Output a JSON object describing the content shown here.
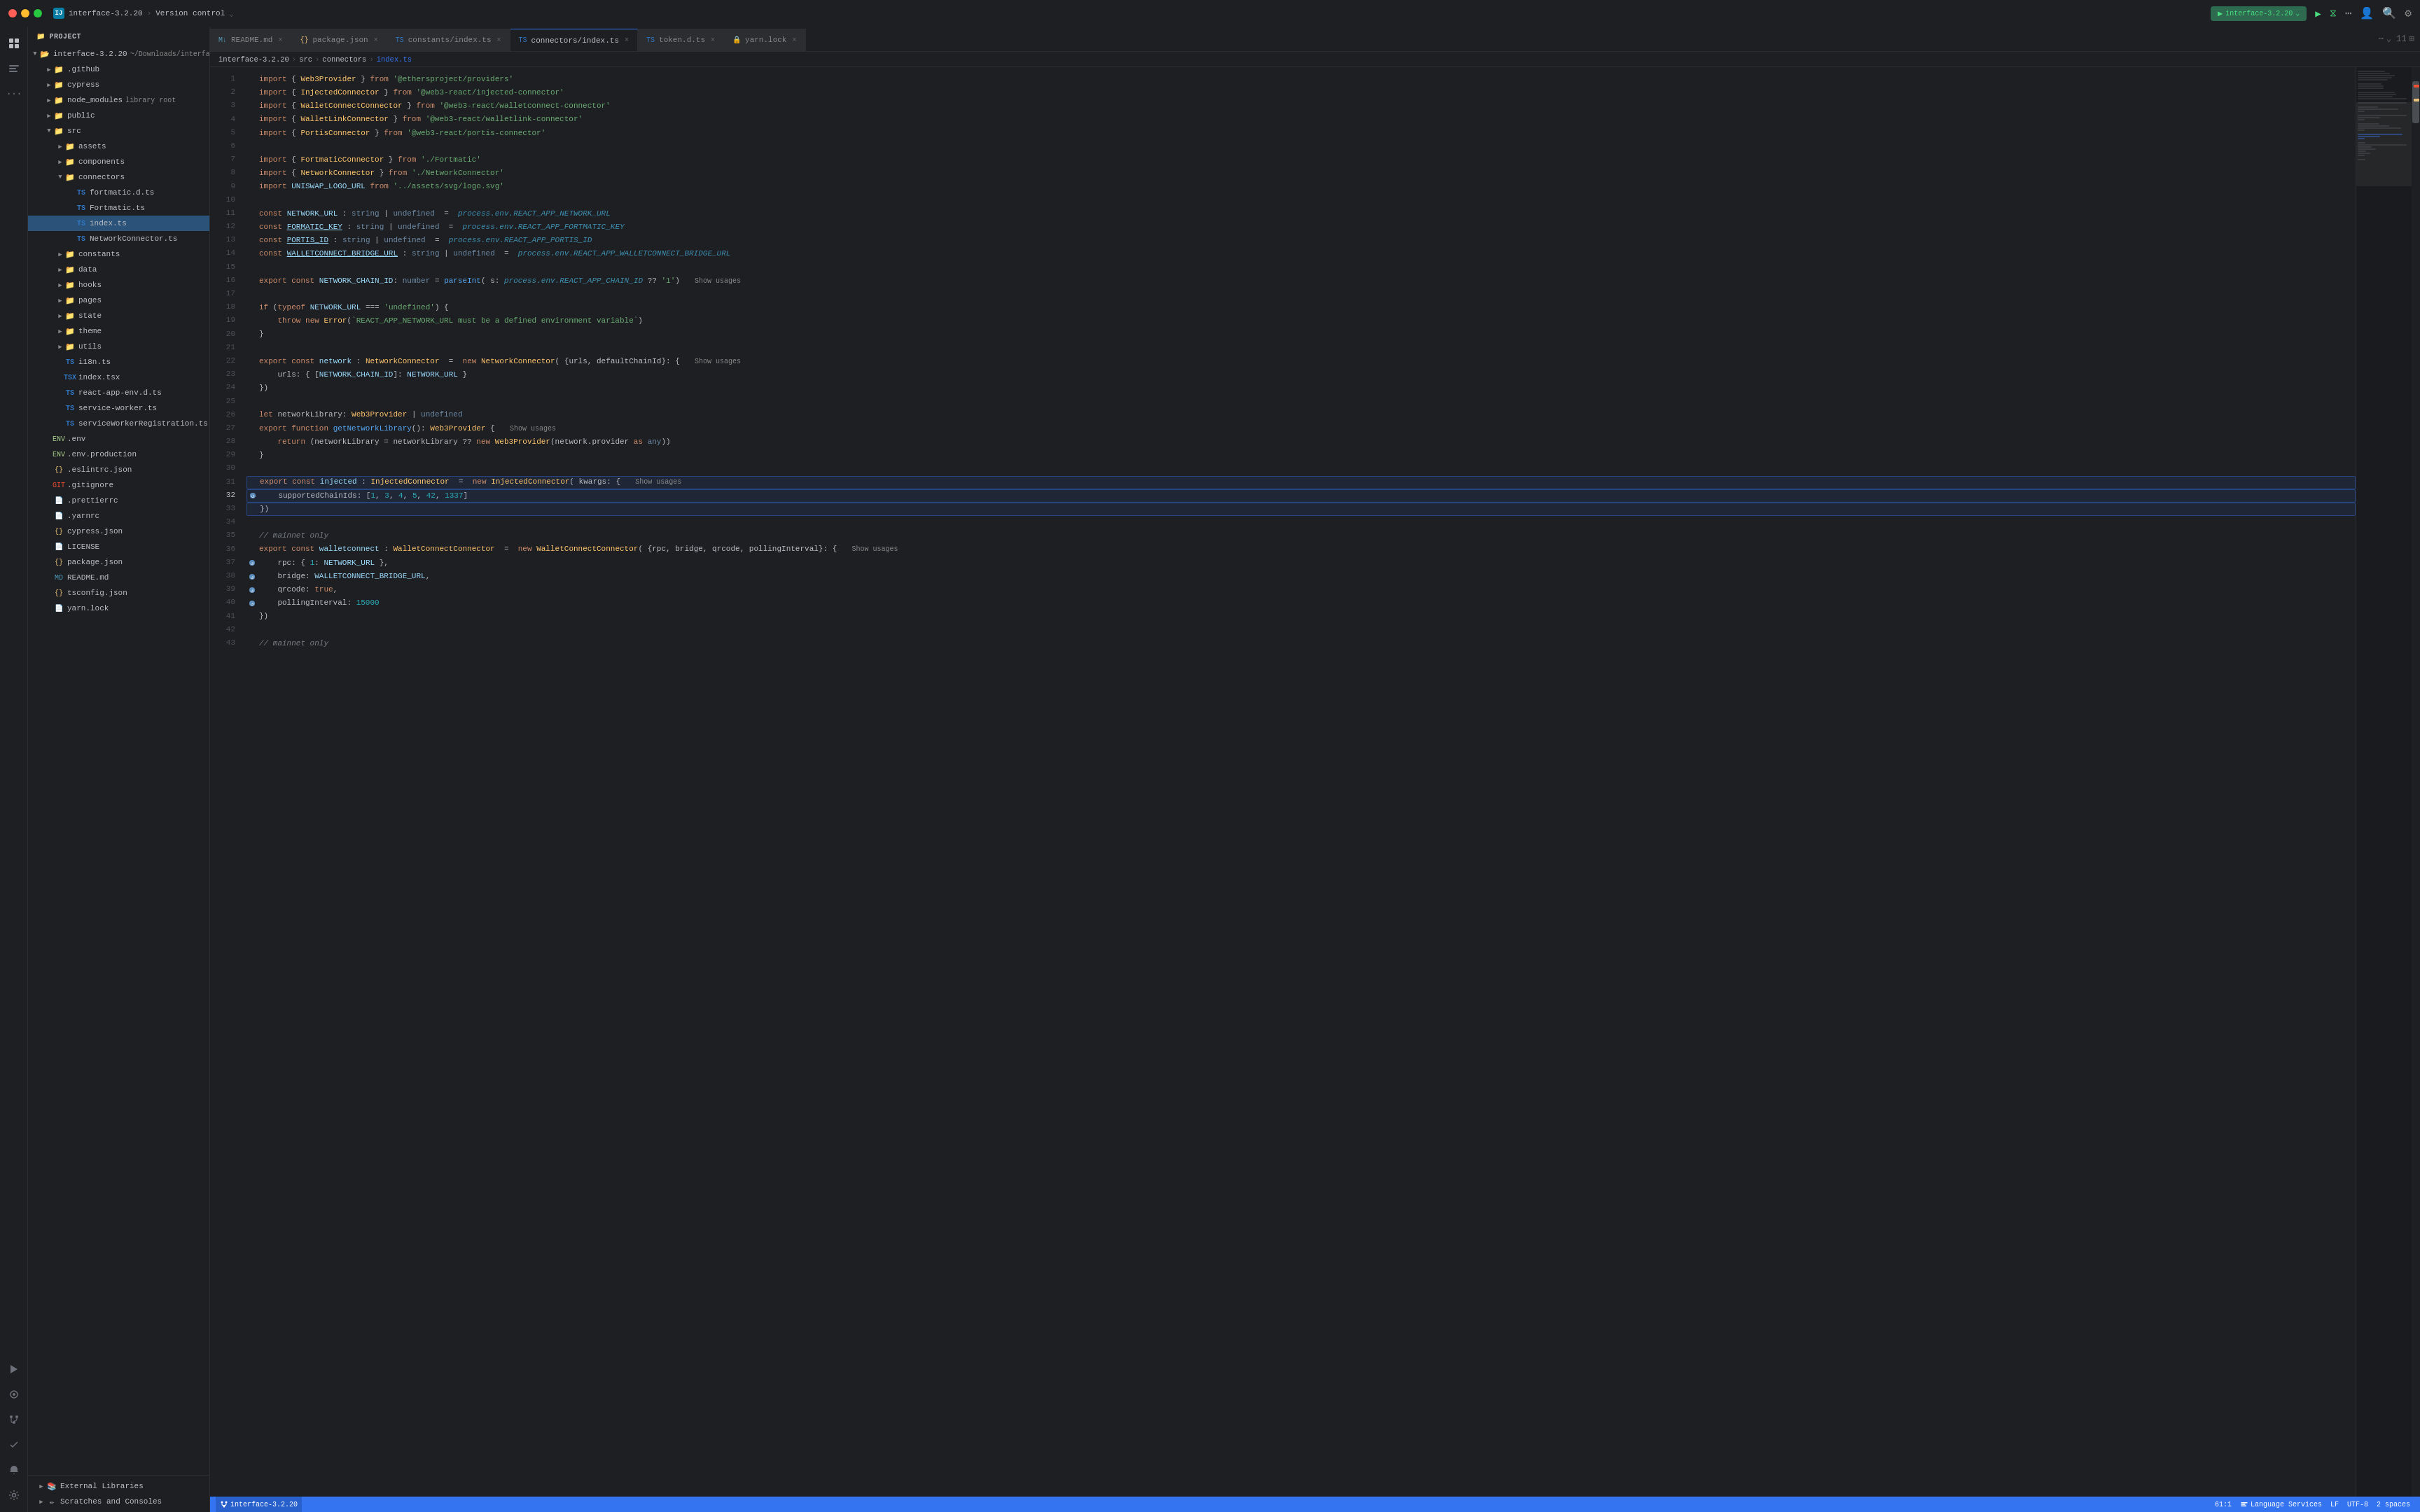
{
  "titleBar": {
    "trafficLights": [
      "close",
      "minimize",
      "maximize"
    ],
    "appName": "interface-3.2.20",
    "appVersion": "interface-3.2.20",
    "versionControl": "Version control",
    "runConfig": "start",
    "appIconLabel": "IJ"
  },
  "activityBar": {
    "icons": [
      {
        "name": "project-icon",
        "symbol": "📁"
      },
      {
        "name": "structure-icon",
        "symbol": "⊞"
      },
      {
        "name": "more-icon",
        "symbol": "···"
      },
      {
        "name": "run-icon",
        "symbol": "▶"
      },
      {
        "name": "debug-icon",
        "symbol": "🐛"
      },
      {
        "name": "git-icon",
        "symbol": "⎇"
      },
      {
        "name": "todo-icon",
        "symbol": "✓"
      },
      {
        "name": "notifications-icon",
        "symbol": "🔔"
      },
      {
        "name": "settings-icon",
        "symbol": "⚙"
      }
    ]
  },
  "sidebar": {
    "header": "Project",
    "tree": [
      {
        "id": "root",
        "label": "interface-3.2.20",
        "suffix": "~/Downloads/interface-3.2.20",
        "type": "folder-open",
        "depth": 0,
        "expanded": true
      },
      {
        "id": "github",
        "label": ".github",
        "type": "folder",
        "depth": 1,
        "expanded": false
      },
      {
        "id": "cypress",
        "label": "cypress",
        "type": "folder",
        "depth": 1,
        "expanded": false
      },
      {
        "id": "node_modules",
        "label": "node_modules",
        "suffix": "library root",
        "type": "folder",
        "depth": 1,
        "expanded": false
      },
      {
        "id": "public",
        "label": "public",
        "type": "folder",
        "depth": 1,
        "expanded": false
      },
      {
        "id": "src",
        "label": "src",
        "type": "folder",
        "depth": 1,
        "expanded": true
      },
      {
        "id": "assets",
        "label": "assets",
        "type": "folder",
        "depth": 2,
        "expanded": false
      },
      {
        "id": "components",
        "label": "components",
        "type": "folder",
        "depth": 2,
        "expanded": false
      },
      {
        "id": "connectors",
        "label": "connectors",
        "type": "folder",
        "depth": 2,
        "expanded": true
      },
      {
        "id": "fortmatic.d.ts",
        "label": "fortmatic.d.ts",
        "type": "ts",
        "depth": 3
      },
      {
        "id": "Fortmatic.ts",
        "label": "Fortmatic.ts",
        "type": "ts",
        "depth": 3
      },
      {
        "id": "index.ts",
        "label": "index.ts",
        "type": "ts",
        "depth": 3,
        "selected": true
      },
      {
        "id": "NetworkConnector.ts",
        "label": "NetworkConnector.ts",
        "type": "ts",
        "depth": 3
      },
      {
        "id": "constants",
        "label": "constants",
        "type": "folder",
        "depth": 2,
        "expanded": false
      },
      {
        "id": "data",
        "label": "data",
        "type": "folder",
        "depth": 2,
        "expanded": false
      },
      {
        "id": "hooks",
        "label": "hooks",
        "type": "folder",
        "depth": 2,
        "expanded": false
      },
      {
        "id": "pages",
        "label": "pages",
        "type": "folder",
        "depth": 2,
        "expanded": false
      },
      {
        "id": "state",
        "label": "state",
        "type": "folder",
        "depth": 2,
        "expanded": false
      },
      {
        "id": "theme",
        "label": "theme",
        "type": "folder",
        "depth": 2,
        "expanded": false
      },
      {
        "id": "utils",
        "label": "utils",
        "type": "folder",
        "depth": 2,
        "expanded": false
      },
      {
        "id": "i18n.ts",
        "label": "i18n.ts",
        "type": "ts",
        "depth": 2
      },
      {
        "id": "index.tsx",
        "label": "index.tsx",
        "type": "tsx",
        "depth": 2
      },
      {
        "id": "react-app-env.d.ts",
        "label": "react-app-env.d.ts",
        "type": "ts",
        "depth": 2
      },
      {
        "id": "service-worker.ts",
        "label": "service-worker.ts",
        "type": "ts",
        "depth": 2
      },
      {
        "id": "serviceWorkerRegistration.ts",
        "label": "serviceWorkerRegistration.ts",
        "type": "ts",
        "depth": 2
      },
      {
        "id": ".env",
        "label": ".env",
        "type": "env",
        "depth": 1
      },
      {
        "id": ".env.production",
        "label": ".env.production",
        "type": "env",
        "depth": 1
      },
      {
        "id": ".eslintrc.json",
        "label": ".eslintrc.json",
        "type": "json",
        "depth": 1
      },
      {
        "id": ".gitignore",
        "label": ".gitignore",
        "type": "git",
        "depth": 1
      },
      {
        "id": ".prettierrc",
        "label": ".prettierrc",
        "type": "file",
        "depth": 1
      },
      {
        "id": ".yarnrc",
        "label": ".yarnrc",
        "type": "file",
        "depth": 1
      },
      {
        "id": "cypress.json",
        "label": "cypress.json",
        "type": "json",
        "depth": 1
      },
      {
        "id": "LICENSE",
        "label": "LICENSE",
        "type": "file",
        "depth": 1
      },
      {
        "id": "package.json",
        "label": "package.json",
        "type": "json",
        "depth": 1
      },
      {
        "id": "README.md",
        "label": "README.md",
        "type": "md",
        "depth": 1
      },
      {
        "id": "tsconfig.json",
        "label": "tsconfig.json",
        "type": "json",
        "depth": 1
      },
      {
        "id": "yarn.lock",
        "label": "yarn.lock",
        "type": "file",
        "depth": 1
      }
    ],
    "bottomItems": [
      {
        "id": "external-libs",
        "label": "External Libraries",
        "type": "folder"
      },
      {
        "id": "scratches",
        "label": "Scratches and Consoles",
        "type": "folder"
      }
    ]
  },
  "tabs": [
    {
      "id": "readme",
      "label": "README.md",
      "type": "md",
      "active": false,
      "modified": false
    },
    {
      "id": "package",
      "label": "package.json",
      "type": "json",
      "active": false,
      "modified": false
    },
    {
      "id": "constants",
      "label": "constants/index.ts",
      "type": "ts",
      "active": false,
      "modified": false
    },
    {
      "id": "connectors",
      "label": "connectors/index.ts",
      "type": "ts",
      "active": true,
      "modified": false
    },
    {
      "id": "token",
      "label": "token.d.ts",
      "type": "ts",
      "active": false,
      "modified": false
    },
    {
      "id": "yarn",
      "label": "yarn.lock",
      "type": "lock",
      "active": false,
      "modified": false
    }
  ],
  "breadcrumb": {
    "items": [
      "interface-3.2.20",
      "src",
      "connectors",
      "index.ts"
    ]
  },
  "editor": {
    "filename": "index.ts",
    "lines": [
      {
        "num": 1,
        "content": "import { Web3Provider } from '@ethersproject/providers'"
      },
      {
        "num": 2,
        "content": "import { InjectedConnector } from '@web3-react/injected-connector'"
      },
      {
        "num": 3,
        "content": "import { WalletConnectConnector } from '@web3-react/walletconnect-connector'"
      },
      {
        "num": 4,
        "content": "import { WalletLinkConnector } from '@web3-react/walletlink-connector'"
      },
      {
        "num": 5,
        "content": "import { PortisConnector } from '@web3-react/portis-connector'"
      },
      {
        "num": 6,
        "content": ""
      },
      {
        "num": 7,
        "content": "import { FortmaticConnector } from './Fortmatic'"
      },
      {
        "num": 8,
        "content": "import { NetworkConnector } from './NetworkConnector'"
      },
      {
        "num": 9,
        "content": "import UNISWAP_LOGO_URL from '../assets/svg/logo.svg'"
      },
      {
        "num": 10,
        "content": ""
      },
      {
        "num": 11,
        "content": "const NETWORK_URL : string | undefined  =  process.env.REACT_APP_NETWORK_URL"
      },
      {
        "num": 12,
        "content": "const FORMATIC_KEY : string | undefined  =  process.env.REACT_APP_FORTMATIC_KEY"
      },
      {
        "num": 13,
        "content": "const PORTIS_ID : string | undefined  =  process.env.REACT_APP_PORTIS_ID"
      },
      {
        "num": 14,
        "content": "const WALLETCONNECT_BRIDGE_URL : string | undefined  =  process.env.REACT_APP_WALLETCONNECT_BRIDGE_URL"
      },
      {
        "num": 15,
        "content": ""
      },
      {
        "num": 16,
        "content": "export const NETWORK_CHAIN_ID: number = parseInt( s: process.env.REACT_APP_CHAIN_ID ?? '1')  Show usages"
      },
      {
        "num": 17,
        "content": ""
      },
      {
        "num": 18,
        "content": "if (typeof NETWORK_URL === 'undefined') {"
      },
      {
        "num": 19,
        "content": "    throw new Error(`REACT_APP_NETWORK_URL must be a defined environment variable`)"
      },
      {
        "num": 20,
        "content": "}"
      },
      {
        "num": 21,
        "content": ""
      },
      {
        "num": 22,
        "content": "export const network : NetworkConnector  =  new NetworkConnector( {urls, defaultChainId}: {  Show usages"
      },
      {
        "num": 23,
        "content": "    urls: { [NETWORK_CHAIN_ID]: NETWORK_URL }"
      },
      {
        "num": 24,
        "content": "})"
      },
      {
        "num": 25,
        "content": ""
      },
      {
        "num": 26,
        "content": "let networkLibrary: Web3Provider | undefined"
      },
      {
        "num": 27,
        "content": "export function getNetworkLibrary(): Web3Provider {  Show usages"
      },
      {
        "num": 28,
        "content": "    return (networkLibrary = networkLibrary ?? new Web3Provider(network.provider as any))"
      },
      {
        "num": 29,
        "content": "}"
      },
      {
        "num": 30,
        "content": ""
      },
      {
        "num": 31,
        "content": "export const injected : InjectedConnector  =  new InjectedConnector( kwargs: {  Show usages",
        "highlighted": true
      },
      {
        "num": 32,
        "content": "    supportedChainIds: [1, 3, 4, 5, 42, 1337]",
        "highlighted": true,
        "hasGutterIcon": true
      },
      {
        "num": 33,
        "content": "})",
        "highlighted": true
      },
      {
        "num": 34,
        "content": ""
      },
      {
        "num": 35,
        "content": "// mainnet only"
      },
      {
        "num": 36,
        "content": "export const walletconnect : WalletConnectConnector  =  new WalletConnectConnector( {rpc, bridge, qrcode, pollingInterval}: {  Show usages"
      },
      {
        "num": 37,
        "content": "    rpc: { 1: NETWORK_URL },",
        "hasGutterIcon": true
      },
      {
        "num": 38,
        "content": "    bridge: WALLETCONNECT_BRIDGE_URL,",
        "hasGutterIcon": true
      },
      {
        "num": 39,
        "content": "    qrcode: true,",
        "hasGutterIcon": true
      },
      {
        "num": 40,
        "content": "    pollingInterval: 15000",
        "hasGutterIcon": true
      },
      {
        "num": 41,
        "content": "})"
      },
      {
        "num": 42,
        "content": ""
      },
      {
        "num": 43,
        "content": "// mainnet only"
      }
    ]
  },
  "statusBar": {
    "branch": "interface-3.2.20",
    "position": "61:1",
    "languageService": "Language Services",
    "lineEnding": "LF",
    "encoding": "UTF-8",
    "indent": "2 spaces",
    "warnings": "11"
  }
}
